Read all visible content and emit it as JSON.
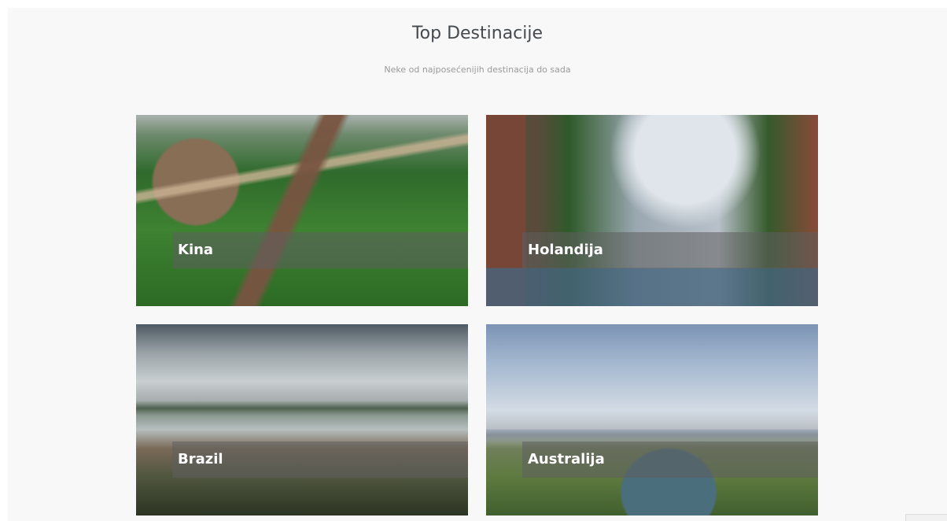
{
  "section": {
    "title": "Top Destinacije",
    "subtitle": "Neke od najposećenijih destinacija do sada"
  },
  "destinations": [
    {
      "label": "Kina"
    },
    {
      "label": "Holandija"
    },
    {
      "label": "Brazil"
    },
    {
      "label": "Australija"
    }
  ]
}
